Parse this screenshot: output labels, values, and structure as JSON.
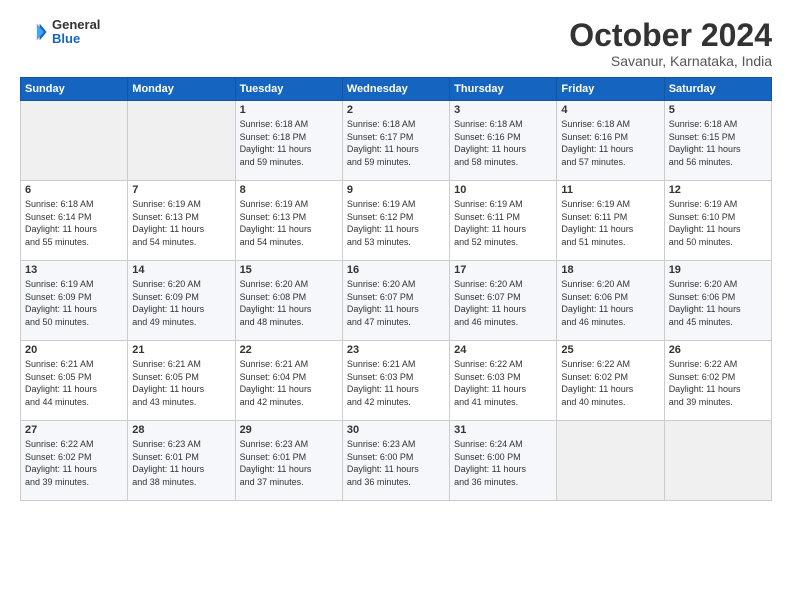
{
  "logo": {
    "general": "General",
    "blue": "Blue"
  },
  "title": "October 2024",
  "location": "Savanur, Karnataka, India",
  "header": {
    "days": [
      "Sunday",
      "Monday",
      "Tuesday",
      "Wednesday",
      "Thursday",
      "Friday",
      "Saturday"
    ]
  },
  "weeks": [
    [
      {
        "day": "",
        "detail": ""
      },
      {
        "day": "",
        "detail": ""
      },
      {
        "day": "1",
        "detail": "Sunrise: 6:18 AM\nSunset: 6:18 PM\nDaylight: 11 hours\nand 59 minutes."
      },
      {
        "day": "2",
        "detail": "Sunrise: 6:18 AM\nSunset: 6:17 PM\nDaylight: 11 hours\nand 59 minutes."
      },
      {
        "day": "3",
        "detail": "Sunrise: 6:18 AM\nSunset: 6:16 PM\nDaylight: 11 hours\nand 58 minutes."
      },
      {
        "day": "4",
        "detail": "Sunrise: 6:18 AM\nSunset: 6:16 PM\nDaylight: 11 hours\nand 57 minutes."
      },
      {
        "day": "5",
        "detail": "Sunrise: 6:18 AM\nSunset: 6:15 PM\nDaylight: 11 hours\nand 56 minutes."
      }
    ],
    [
      {
        "day": "6",
        "detail": "Sunrise: 6:18 AM\nSunset: 6:14 PM\nDaylight: 11 hours\nand 55 minutes."
      },
      {
        "day": "7",
        "detail": "Sunrise: 6:19 AM\nSunset: 6:13 PM\nDaylight: 11 hours\nand 54 minutes."
      },
      {
        "day": "8",
        "detail": "Sunrise: 6:19 AM\nSunset: 6:13 PM\nDaylight: 11 hours\nand 54 minutes."
      },
      {
        "day": "9",
        "detail": "Sunrise: 6:19 AM\nSunset: 6:12 PM\nDaylight: 11 hours\nand 53 minutes."
      },
      {
        "day": "10",
        "detail": "Sunrise: 6:19 AM\nSunset: 6:11 PM\nDaylight: 11 hours\nand 52 minutes."
      },
      {
        "day": "11",
        "detail": "Sunrise: 6:19 AM\nSunset: 6:11 PM\nDaylight: 11 hours\nand 51 minutes."
      },
      {
        "day": "12",
        "detail": "Sunrise: 6:19 AM\nSunset: 6:10 PM\nDaylight: 11 hours\nand 50 minutes."
      }
    ],
    [
      {
        "day": "13",
        "detail": "Sunrise: 6:19 AM\nSunset: 6:09 PM\nDaylight: 11 hours\nand 50 minutes."
      },
      {
        "day": "14",
        "detail": "Sunrise: 6:20 AM\nSunset: 6:09 PM\nDaylight: 11 hours\nand 49 minutes."
      },
      {
        "day": "15",
        "detail": "Sunrise: 6:20 AM\nSunset: 6:08 PM\nDaylight: 11 hours\nand 48 minutes."
      },
      {
        "day": "16",
        "detail": "Sunrise: 6:20 AM\nSunset: 6:07 PM\nDaylight: 11 hours\nand 47 minutes."
      },
      {
        "day": "17",
        "detail": "Sunrise: 6:20 AM\nSunset: 6:07 PM\nDaylight: 11 hours\nand 46 minutes."
      },
      {
        "day": "18",
        "detail": "Sunrise: 6:20 AM\nSunset: 6:06 PM\nDaylight: 11 hours\nand 46 minutes."
      },
      {
        "day": "19",
        "detail": "Sunrise: 6:20 AM\nSunset: 6:06 PM\nDaylight: 11 hours\nand 45 minutes."
      }
    ],
    [
      {
        "day": "20",
        "detail": "Sunrise: 6:21 AM\nSunset: 6:05 PM\nDaylight: 11 hours\nand 44 minutes."
      },
      {
        "day": "21",
        "detail": "Sunrise: 6:21 AM\nSunset: 6:05 PM\nDaylight: 11 hours\nand 43 minutes."
      },
      {
        "day": "22",
        "detail": "Sunrise: 6:21 AM\nSunset: 6:04 PM\nDaylight: 11 hours\nand 42 minutes."
      },
      {
        "day": "23",
        "detail": "Sunrise: 6:21 AM\nSunset: 6:03 PM\nDaylight: 11 hours\nand 42 minutes."
      },
      {
        "day": "24",
        "detail": "Sunrise: 6:22 AM\nSunset: 6:03 PM\nDaylight: 11 hours\nand 41 minutes."
      },
      {
        "day": "25",
        "detail": "Sunrise: 6:22 AM\nSunset: 6:02 PM\nDaylight: 11 hours\nand 40 minutes."
      },
      {
        "day": "26",
        "detail": "Sunrise: 6:22 AM\nSunset: 6:02 PM\nDaylight: 11 hours\nand 39 minutes."
      }
    ],
    [
      {
        "day": "27",
        "detail": "Sunrise: 6:22 AM\nSunset: 6:02 PM\nDaylight: 11 hours\nand 39 minutes."
      },
      {
        "day": "28",
        "detail": "Sunrise: 6:23 AM\nSunset: 6:01 PM\nDaylight: 11 hours\nand 38 minutes."
      },
      {
        "day": "29",
        "detail": "Sunrise: 6:23 AM\nSunset: 6:01 PM\nDaylight: 11 hours\nand 37 minutes."
      },
      {
        "day": "30",
        "detail": "Sunrise: 6:23 AM\nSunset: 6:00 PM\nDaylight: 11 hours\nand 36 minutes."
      },
      {
        "day": "31",
        "detail": "Sunrise: 6:24 AM\nSunset: 6:00 PM\nDaylight: 11 hours\nand 36 minutes."
      },
      {
        "day": "",
        "detail": ""
      },
      {
        "day": "",
        "detail": ""
      }
    ]
  ]
}
